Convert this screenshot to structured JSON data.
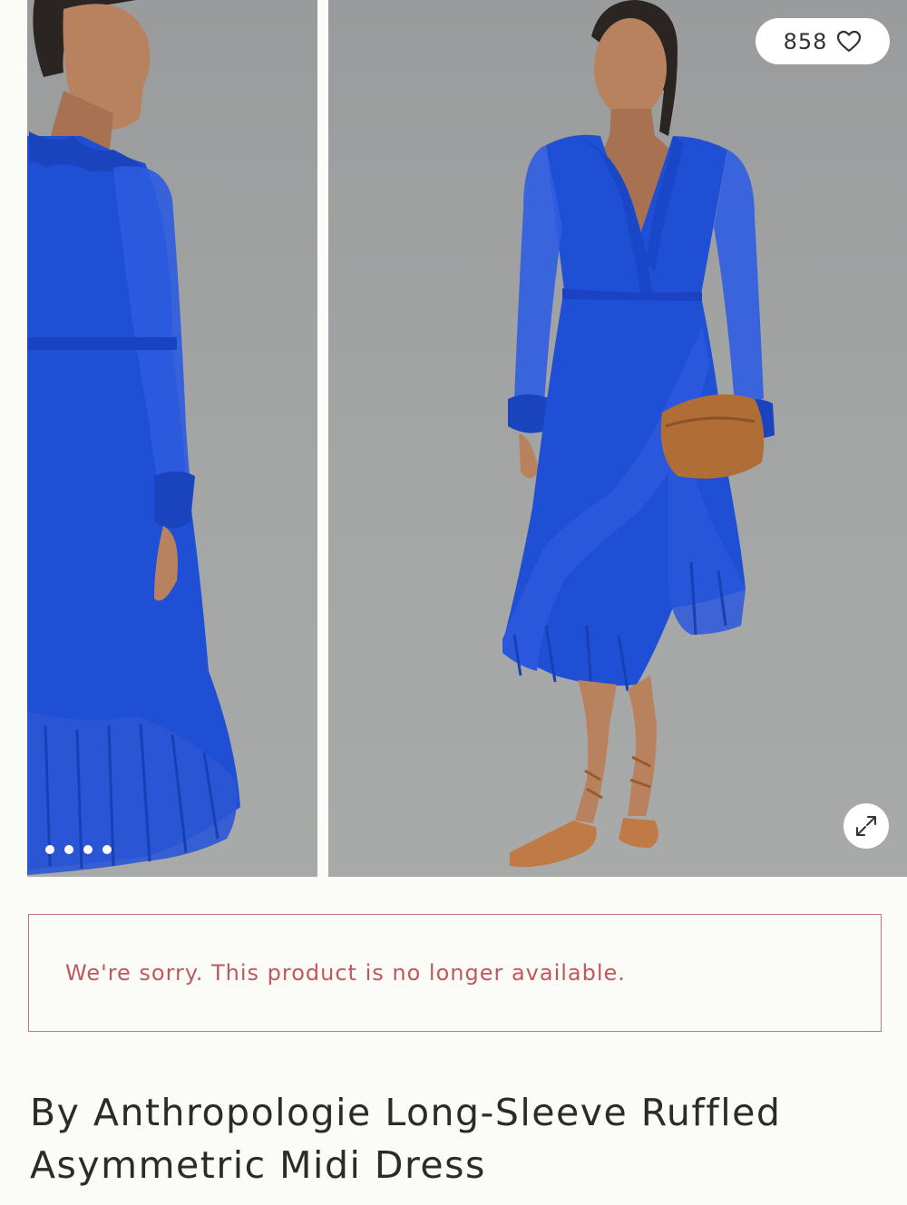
{
  "product": {
    "title": "By Anthropologie Long-Sleeve Ruffled Asymmetric Midi Dress",
    "unavailable_message": "We're sorry. This product is no longer available.",
    "favorites_count": "858"
  },
  "gallery": {
    "dot_count": 4,
    "icons": {
      "favorite": "heart-outline-icon",
      "expand": "expand-arrows-icon"
    }
  },
  "colors": {
    "dress": "#1f4fd4",
    "background": "#fbfbf7",
    "notice_border": "#c9737a",
    "notice_text": "#c0585f"
  }
}
